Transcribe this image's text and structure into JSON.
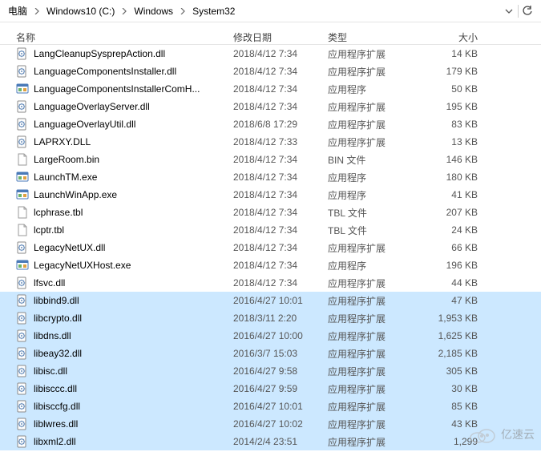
{
  "breadcrumb": {
    "items": [
      "电脑",
      "Windows10 (C:)",
      "Windows",
      "System32"
    ]
  },
  "columns": {
    "name": "名称",
    "date": "修改日期",
    "type": "类型",
    "size": "大小"
  },
  "icons": {
    "dll": "gear-page-icon",
    "exe": "app-icon",
    "tbl": "file-icon",
    "bin": "file-icon"
  },
  "files": [
    {
      "icon": "dll",
      "name": "LangCleanupSysprepAction.dll",
      "date": "2018/4/12 7:34",
      "type": "应用程序扩展",
      "size": "14 KB",
      "selected": false
    },
    {
      "icon": "dll",
      "name": "LanguageComponentsInstaller.dll",
      "date": "2018/4/12 7:34",
      "type": "应用程序扩展",
      "size": "179 KB",
      "selected": false
    },
    {
      "icon": "exe",
      "name": "LanguageComponentsInstallerComH...",
      "date": "2018/4/12 7:34",
      "type": "应用程序",
      "size": "50 KB",
      "selected": false
    },
    {
      "icon": "dll",
      "name": "LanguageOverlayServer.dll",
      "date": "2018/4/12 7:34",
      "type": "应用程序扩展",
      "size": "195 KB",
      "selected": false
    },
    {
      "icon": "dll",
      "name": "LanguageOverlayUtil.dll",
      "date": "2018/6/8 17:29",
      "type": "应用程序扩展",
      "size": "83 KB",
      "selected": false
    },
    {
      "icon": "dll",
      "name": "LAPRXY.DLL",
      "date": "2018/4/12 7:33",
      "type": "应用程序扩展",
      "size": "13 KB",
      "selected": false
    },
    {
      "icon": "bin",
      "name": "LargeRoom.bin",
      "date": "2018/4/12 7:34",
      "type": "BIN 文件",
      "size": "146 KB",
      "selected": false
    },
    {
      "icon": "exe",
      "name": "LaunchTM.exe",
      "date": "2018/4/12 7:34",
      "type": "应用程序",
      "size": "180 KB",
      "selected": false
    },
    {
      "icon": "exe",
      "name": "LaunchWinApp.exe",
      "date": "2018/4/12 7:34",
      "type": "应用程序",
      "size": "41 KB",
      "selected": false
    },
    {
      "icon": "tbl",
      "name": "lcphrase.tbl",
      "date": "2018/4/12 7:34",
      "type": "TBL 文件",
      "size": "207 KB",
      "selected": false
    },
    {
      "icon": "tbl",
      "name": "lcptr.tbl",
      "date": "2018/4/12 7:34",
      "type": "TBL 文件",
      "size": "24 KB",
      "selected": false
    },
    {
      "icon": "dll",
      "name": "LegacyNetUX.dll",
      "date": "2018/4/12 7:34",
      "type": "应用程序扩展",
      "size": "66 KB",
      "selected": false
    },
    {
      "icon": "exe",
      "name": "LegacyNetUXHost.exe",
      "date": "2018/4/12 7:34",
      "type": "应用程序",
      "size": "196 KB",
      "selected": false
    },
    {
      "icon": "dll",
      "name": "lfsvc.dll",
      "date": "2018/4/12 7:34",
      "type": "应用程序扩展",
      "size": "44 KB",
      "selected": false
    },
    {
      "icon": "dll",
      "name": "libbind9.dll",
      "date": "2016/4/27 10:01",
      "type": "应用程序扩展",
      "size": "47 KB",
      "selected": true
    },
    {
      "icon": "dll",
      "name": "libcrypto.dll",
      "date": "2018/3/11 2:20",
      "type": "应用程序扩展",
      "size": "1,953 KB",
      "selected": true
    },
    {
      "icon": "dll",
      "name": "libdns.dll",
      "date": "2016/4/27 10:00",
      "type": "应用程序扩展",
      "size": "1,625 KB",
      "selected": true
    },
    {
      "icon": "dll",
      "name": "libeay32.dll",
      "date": "2016/3/7 15:03",
      "type": "应用程序扩展",
      "size": "2,185 KB",
      "selected": true
    },
    {
      "icon": "dll",
      "name": "libisc.dll",
      "date": "2016/4/27 9:58",
      "type": "应用程序扩展",
      "size": "305 KB",
      "selected": true
    },
    {
      "icon": "dll",
      "name": "libisccc.dll",
      "date": "2016/4/27 9:59",
      "type": "应用程序扩展",
      "size": "30 KB",
      "selected": true
    },
    {
      "icon": "dll",
      "name": "libisccfg.dll",
      "date": "2016/4/27 10:01",
      "type": "应用程序扩展",
      "size": "85 KB",
      "selected": true
    },
    {
      "icon": "dll",
      "name": "liblwres.dll",
      "date": "2016/4/27 10:02",
      "type": "应用程序扩展",
      "size": "43 KB",
      "selected": true
    },
    {
      "icon": "dll",
      "name": "libxml2.dll",
      "date": "2014/2/4 23:51",
      "type": "应用程序扩展",
      "size": "1,299",
      "selected": true
    }
  ],
  "watermark": {
    "text": "亿速云"
  }
}
